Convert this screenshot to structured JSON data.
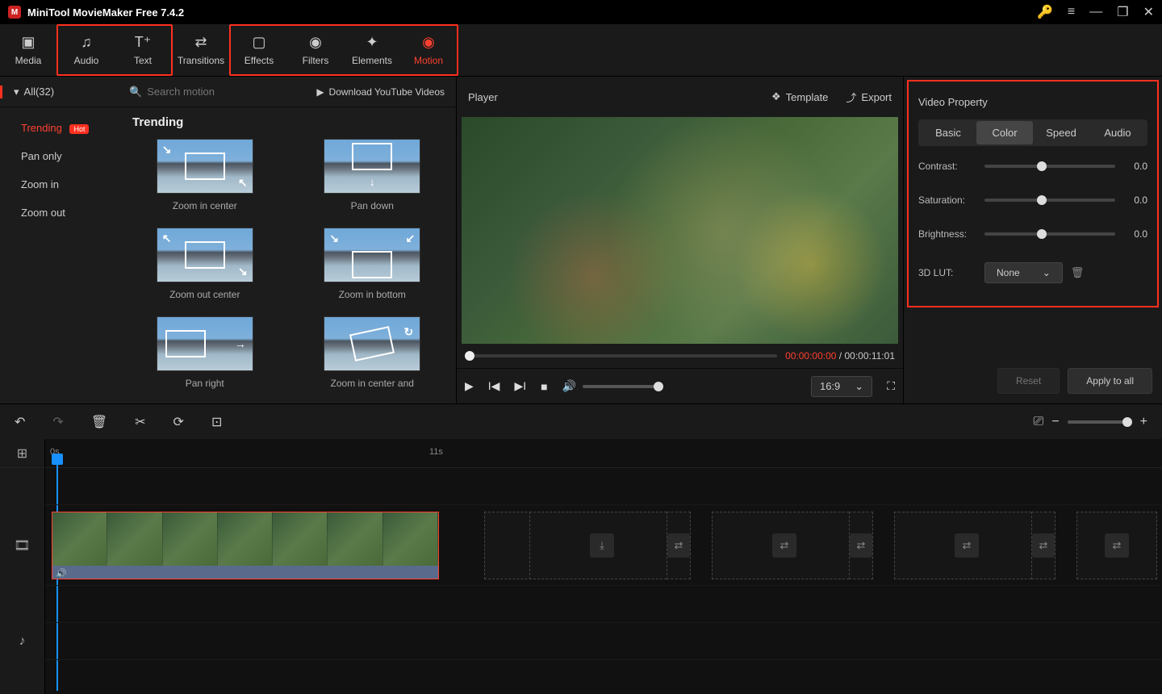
{
  "app": {
    "title": "MiniTool MovieMaker Free 7.4.2"
  },
  "toolbar": {
    "media": "Media",
    "audio": "Audio",
    "text": "Text",
    "transitions": "Transitions",
    "effects": "Effects",
    "filters": "Filters",
    "elements": "Elements",
    "motion": "Motion"
  },
  "leftpanel": {
    "all_label": "All(32)",
    "search_placeholder": "Search motion",
    "download_yt": "Download YouTube Videos",
    "categories": {
      "trending": "Trending",
      "hot": "Hot",
      "pan_only": "Pan only",
      "zoom_in": "Zoom in",
      "zoom_out": "Zoom out"
    },
    "gallery_title": "Trending",
    "items": [
      "Zoom in center",
      "Pan down",
      "Zoom out center",
      "Zoom in bottom",
      "Pan right",
      "Zoom in center and"
    ]
  },
  "player": {
    "title": "Player",
    "template": "Template",
    "export": "Export",
    "time_current": "00:00:00:00",
    "time_sep": " / ",
    "time_total": "00:00:11:01",
    "ratio": "16:9"
  },
  "props": {
    "title": "Video Property",
    "tabs": {
      "basic": "Basic",
      "color": "Color",
      "speed": "Speed",
      "audio": "Audio"
    },
    "contrast": {
      "label": "Contrast:",
      "value": "0.0"
    },
    "saturation": {
      "label": "Saturation:",
      "value": "0.0"
    },
    "brightness": {
      "label": "Brightness:",
      "value": "0.0"
    },
    "lut": {
      "label": "3D LUT:",
      "value": "None"
    },
    "reset": "Reset",
    "apply": "Apply to all"
  },
  "timeline": {
    "tick0": "0s",
    "tick11": "11s"
  }
}
